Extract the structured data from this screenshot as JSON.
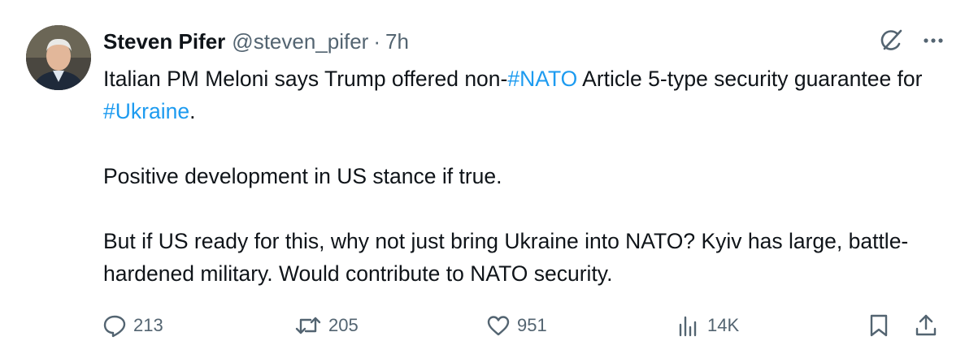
{
  "author": {
    "name": "Steven Pifer",
    "handle": "@steven_pifer",
    "separator": "·",
    "time": "7h"
  },
  "tweet": {
    "line1_before": "Italian PM Meloni says Trump offered non-",
    "tag_nato": "#NATO",
    "line1_after": " Article 5-type security guarantee for ",
    "tag_ukraine": "#Ukraine",
    "line1_end": ".",
    "paragraph2": "Positive development in US stance if true.",
    "paragraph3": "But if US ready for this, why not just bring Ukraine into NATO? Kyiv has large, battle-hardened military. Would contribute to NATO security."
  },
  "actions": {
    "replies": "213",
    "reposts": "205",
    "likes": "951",
    "views": "14K"
  },
  "icons": {
    "top": [
      "grok-icon",
      "more-icon"
    ],
    "bottom": [
      "reply-icon",
      "repost-icon",
      "like-icon",
      "views-icon",
      "bookmark-icon",
      "share-icon"
    ]
  },
  "colors": {
    "link": "#1d9bf0",
    "text": "#0f1419",
    "secondary": "#536471"
  }
}
